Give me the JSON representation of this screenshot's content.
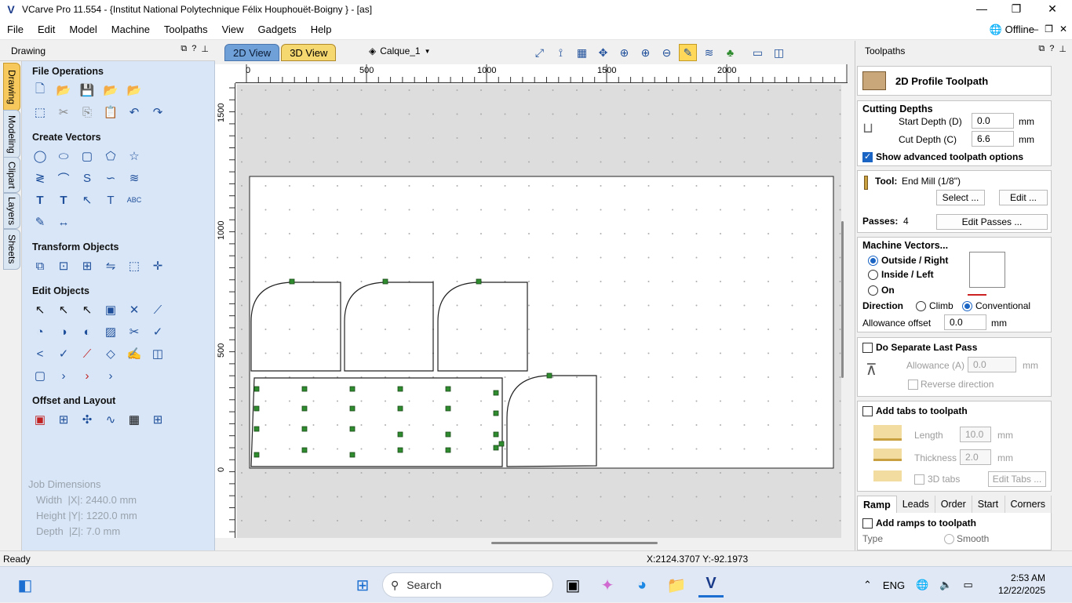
{
  "window": {
    "title": "VCarve Pro 11.554 - {Institut National Polytechnique Félix Houphouët-Boigny } - [as]",
    "controls": [
      "—",
      "❐",
      "✕"
    ]
  },
  "menu": {
    "items": [
      "File",
      "Edit",
      "Model",
      "Machine",
      "Toolpaths",
      "View",
      "Gadgets",
      "Help"
    ],
    "offline_label": "Offline",
    "mdi_controls": [
      "—",
      "❐",
      "✕"
    ]
  },
  "left_tabs": [
    "Drawing",
    "Modeling",
    "Clipart",
    "Layers",
    "Sheets"
  ],
  "drawing_panel": {
    "title": "Drawing",
    "sections": {
      "file_operations": "File Operations",
      "create_vectors": "Create Vectors",
      "transform_objects": "Transform Objects",
      "edit_objects": "Edit Objects",
      "offset_layout": "Offset and Layout"
    },
    "job_dimensions": {
      "title": "Job Dimensions",
      "width": "Width  |X|: 2440.0 mm",
      "height": "Height |Y|: 1220.0 mm",
      "depth": "Depth  |Z|: 7.0 mm"
    }
  },
  "view": {
    "tab_2d": "2D View",
    "tab_3d": "3D View",
    "layer": "Calque_1",
    "h_ruler_labels": [
      "0",
      "500",
      "1000",
      "1500",
      "2000"
    ],
    "v_ruler_labels": [
      "1500",
      "1000",
      "500",
      "0"
    ]
  },
  "toolpaths_panel": {
    "title": "Toolpaths",
    "header": "2D Profile Toolpath",
    "cutting_depths": {
      "title": "Cutting Depths",
      "start_label": "Start Depth (D)",
      "start_value": "0.0",
      "cut_label": "Cut Depth (C)",
      "cut_value": "6.6",
      "unit": "mm",
      "advanced_label": "Show advanced toolpath options",
      "advanced_checked": true
    },
    "tool": {
      "label": "Tool:",
      "name": "End Mill (1/8\")",
      "select_btn": "Select ...",
      "edit_btn": "Edit ..."
    },
    "passes": {
      "label": "Passes:",
      "value": "4",
      "edit_btn": "Edit Passes ..."
    },
    "machine_vectors": {
      "title": "Machine Vectors...",
      "outside": "Outside / Right",
      "inside": "Inside / Left",
      "on": "On",
      "selected": "outside",
      "direction_label": "Direction",
      "climb": "Climb",
      "conventional": "Conventional",
      "direction_selected": "conventional",
      "allowance_label": "Allowance offset",
      "allowance_value": "0.0",
      "unit": "mm"
    },
    "last_pass": {
      "title": "Do Separate Last Pass",
      "allowance_label": "Allowance (A)",
      "allowance_value": "0.0",
      "unit": "mm",
      "reverse_label": "Reverse direction"
    },
    "tabs": {
      "title": "Add tabs to toolpath",
      "length_label": "Length",
      "length_value": "10.0",
      "thickness_label": "Thickness",
      "thickness_value": "2.0",
      "unit": "mm",
      "tabs3d_label": "3D tabs",
      "edit_btn": "Edit Tabs ..."
    },
    "subtabs": [
      "Ramp",
      "Leads",
      "Order",
      "Start At",
      "Corners"
    ],
    "ramp": {
      "title": "Add ramps to toolpath",
      "type_label": "Type",
      "smooth_label": "Smooth"
    }
  },
  "status": {
    "text": "Ready",
    "coords": "X:2124.3707 Y:-92.1973"
  },
  "taskbar": {
    "search_placeholder": "Search",
    "lang": "ENG",
    "time": "2:53 AM",
    "date": "12/22/2025"
  },
  "colors": {
    "panel_blue": "#d8e6f7",
    "accent": "#1a64c4",
    "tab_orange": "#f7c95c",
    "node_green": "#2e8b2e"
  }
}
